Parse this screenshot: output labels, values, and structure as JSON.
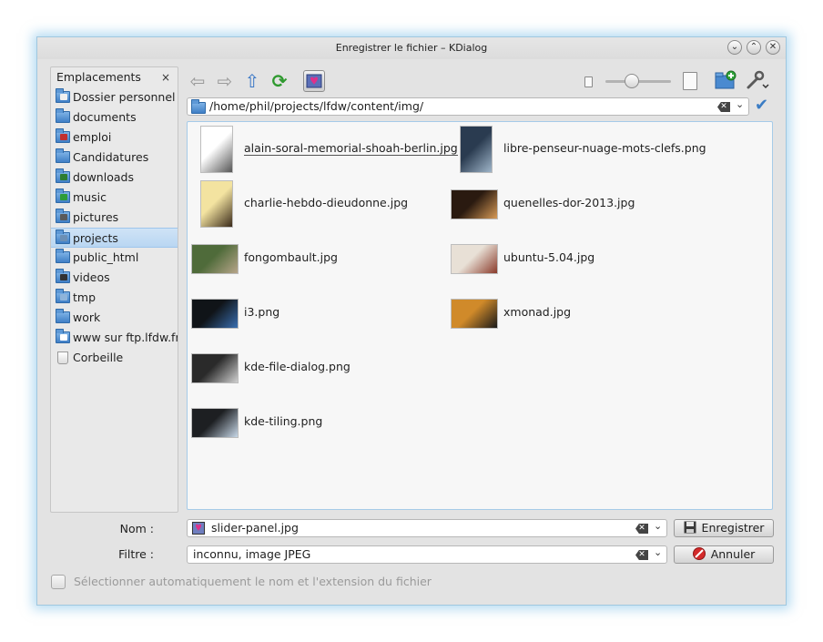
{
  "window": {
    "title": "Enregistrer le fichier – KDialog"
  },
  "wm": {
    "minimize": "⌄",
    "maximize": "⌃",
    "close": "✕"
  },
  "places": {
    "header": "Emplacements",
    "close": "×",
    "items": [
      {
        "label": "Dossier personnel",
        "icon": "home-folder-icon",
        "badge": "#f0f0f0"
      },
      {
        "label": "documents",
        "icon": "folder-icon"
      },
      {
        "label": "emploi",
        "icon": "folder-icon",
        "badge": "#c23030"
      },
      {
        "label": "Candidatures",
        "icon": "folder-icon"
      },
      {
        "label": "downloads",
        "icon": "downloads-folder-icon",
        "badge": "#2e7d32"
      },
      {
        "label": "music",
        "icon": "music-folder-icon",
        "badge": "#2e9c3a"
      },
      {
        "label": "pictures",
        "icon": "pictures-folder-icon",
        "badge": "#5a5a5a"
      },
      {
        "label": "projects",
        "icon": "projects-folder-icon",
        "badge": "#6b8fb5",
        "selected": true
      },
      {
        "label": "public_html",
        "icon": "folder-icon"
      },
      {
        "label": "videos",
        "icon": "videos-folder-icon",
        "badge": "#333333"
      },
      {
        "label": "tmp",
        "icon": "folder-icon",
        "badge": "#8fb4da"
      },
      {
        "label": "work",
        "icon": "folder-icon"
      },
      {
        "label": "www sur ftp.lfdw.fr",
        "icon": "network-folder-icon",
        "badge": "#ffffff"
      },
      {
        "label": "Corbeille",
        "icon": "trash-icon"
      }
    ]
  },
  "toolbar": {
    "back": "⇦",
    "forward": "⇨",
    "up": "⇧",
    "reload": "⟳",
    "zoom_level": 0.4
  },
  "location": {
    "path": "/home/phil/projects/lfdw/content/img/",
    "clear": "✕",
    "dropdown": "⌄",
    "ok": "✔"
  },
  "files": [
    {
      "name": "alain-soral-memorial-shoah-berlin.jpg",
      "thumb_colors": [
        "#ffffff",
        "#555555"
      ],
      "shape": "tall",
      "hover": true
    },
    {
      "name": "libre-penseur-nuage-mots-clefs.png",
      "thumb_colors": [
        "#2a3b50",
        "#9fb5c9"
      ],
      "shape": "tall"
    },
    {
      "name": "charlie-hebdo-dieudonne.jpg",
      "thumb_colors": [
        "#f3e3a0",
        "#3a2a1a"
      ],
      "shape": "tall"
    },
    {
      "name": "quenelles-dor-2013.jpg",
      "thumb_colors": [
        "#2a1a10",
        "#d79a56"
      ],
      "shape": "flat"
    },
    {
      "name": "fongombault.jpg",
      "thumb_colors": [
        "#4f6b3a",
        "#b7a58a"
      ],
      "shape": "flat"
    },
    {
      "name": "ubuntu-5.04.jpg",
      "thumb_colors": [
        "#e8e0d6",
        "#8a3a2a"
      ],
      "shape": "flat"
    },
    {
      "name": "i3.png",
      "thumb_colors": [
        "#101418",
        "#3a6fb0"
      ],
      "shape": "flat"
    },
    {
      "name": "xmonad.jpg",
      "thumb_colors": [
        "#d08a2a",
        "#1a1a1a"
      ],
      "shape": "flat"
    },
    {
      "name": "kde-file-dialog.png",
      "thumb_colors": [
        "#2a2a2a",
        "#d0d0d0"
      ],
      "shape": "flat"
    },
    {
      "name": "kde-tiling.png",
      "thumb_colors": [
        "#1d1f22",
        "#c8d8e8"
      ],
      "shape": "flat"
    }
  ],
  "name_field": {
    "label": "Nom :",
    "value": "slider-panel.jpg",
    "clear": "✕",
    "dropdown": "⌄"
  },
  "filter_field": {
    "label": "Filtre :",
    "value": "inconnu, image JPEG",
    "clear": "✕",
    "dropdown": "⌄"
  },
  "buttons": {
    "save": "Enregistrer",
    "cancel": "Annuler"
  },
  "auto_ext": {
    "label": "Sélectionner automatiquement le nom et l'extension du fichier",
    "checked": false
  }
}
